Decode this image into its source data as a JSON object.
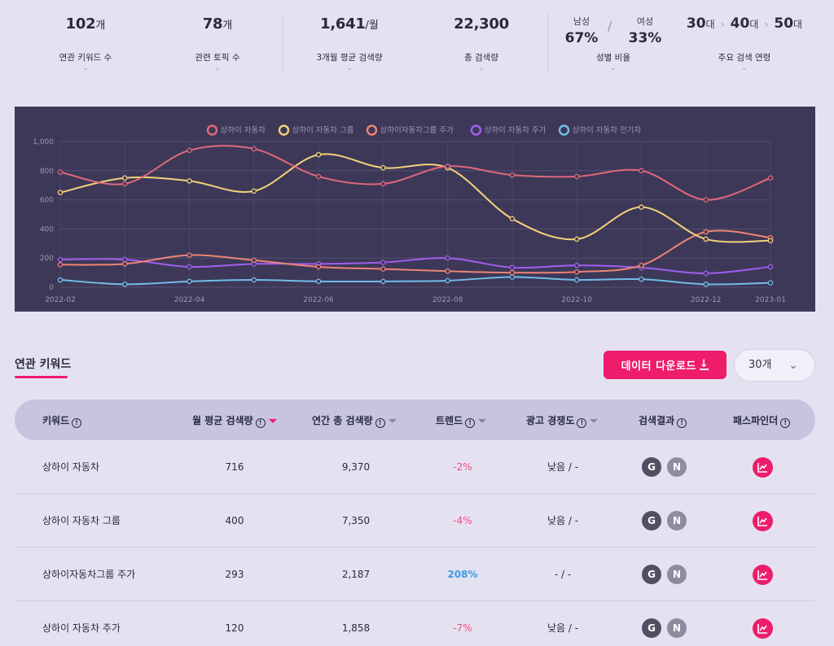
{
  "stats": [
    {
      "value": "102",
      "unit": "개",
      "label": "연관 키워드 수"
    },
    {
      "value": "78",
      "unit": "개",
      "label": "관련 토픽 수"
    },
    {
      "value": "1,641",
      "unit": "/월",
      "label": "3개월 평균 검색량"
    },
    {
      "value": "22,300",
      "unit": "",
      "label": "총 검색량"
    }
  ],
  "gender": {
    "male_label": "남성",
    "male_value": "67%",
    "female_label": "여성",
    "female_value": "33%",
    "label": "성별 비율"
  },
  "ages": {
    "values": [
      "30",
      "40",
      "50"
    ],
    "unit": "대",
    "label": "주요 검색 연령"
  },
  "chart_data": {
    "type": "line",
    "x": [
      "2022-02",
      "2022-03",
      "2022-04",
      "2022-05",
      "2022-06",
      "2022-07",
      "2022-08",
      "2022-09",
      "2022-10",
      "2022-11",
      "2022-12",
      "2023-01"
    ],
    "x_tick_labels": [
      "2022-02",
      "2022-04",
      "2022-06",
      "2022-08",
      "2022-10",
      "2022-12",
      "2023-01"
    ],
    "y_tick_labels": [
      "1,000",
      "800",
      "600",
      "400",
      "200",
      "0"
    ],
    "ylim": [
      0,
      1000
    ],
    "grid": true,
    "legend_position": "top-center",
    "series": [
      {
        "name": "상하이 자동차",
        "color": "#e0687a",
        "values": [
          790,
          710,
          940,
          950,
          760,
          710,
          830,
          770,
          760,
          800,
          600,
          750
        ]
      },
      {
        "name": "상하이 자동차 그룹",
        "color": "#f2d27a",
        "values": [
          650,
          750,
          730,
          660,
          910,
          820,
          820,
          470,
          330,
          550,
          330,
          320
        ]
      },
      {
        "name": "상하이자동차그룹 주가",
        "color": "#ec8474",
        "values": [
          155,
          160,
          220,
          185,
          140,
          125,
          110,
          100,
          105,
          150,
          380,
          340
        ]
      },
      {
        "name": "상하이 자동차 주가",
        "color": "#9f5ff0",
        "values": [
          190,
          190,
          140,
          160,
          160,
          170,
          200,
          135,
          150,
          135,
          95,
          140
        ]
      },
      {
        "name": "상하이 자동차 전기차",
        "color": "#72bde6",
        "values": [
          50,
          20,
          40,
          50,
          40,
          40,
          45,
          70,
          50,
          55,
          20,
          30
        ]
      }
    ]
  },
  "section": {
    "title": "연관 키워드"
  },
  "download_label": "데이터 다운로드",
  "count_select": "30개",
  "table": {
    "headers": [
      "키워드",
      "월 평균 검색량",
      "연간 총 검색량",
      "트렌드",
      "광고 경쟁도",
      "검색결과",
      "패스파인더"
    ],
    "rows": [
      {
        "keyword": "상하이 자동차",
        "monthly": "716",
        "annual": "9,370",
        "trend": "-2%",
        "trend_dir": "neg",
        "competition": "낮음 / -"
      },
      {
        "keyword": "상하이 자동차 그룹",
        "monthly": "400",
        "annual": "7,350",
        "trend": "-4%",
        "trend_dir": "neg",
        "competition": "낮음 / -"
      },
      {
        "keyword": "상하이자동차그룹 주가",
        "monthly": "293",
        "annual": "2,187",
        "trend": "208%",
        "trend_dir": "pos",
        "competition": "- / -"
      },
      {
        "keyword": "상하이 자동차 주가",
        "monthly": "120",
        "annual": "1,858",
        "trend": "-7%",
        "trend_dir": "neg",
        "competition": "낮음 / -"
      }
    ],
    "google_label": "G",
    "naver_label": "N"
  }
}
